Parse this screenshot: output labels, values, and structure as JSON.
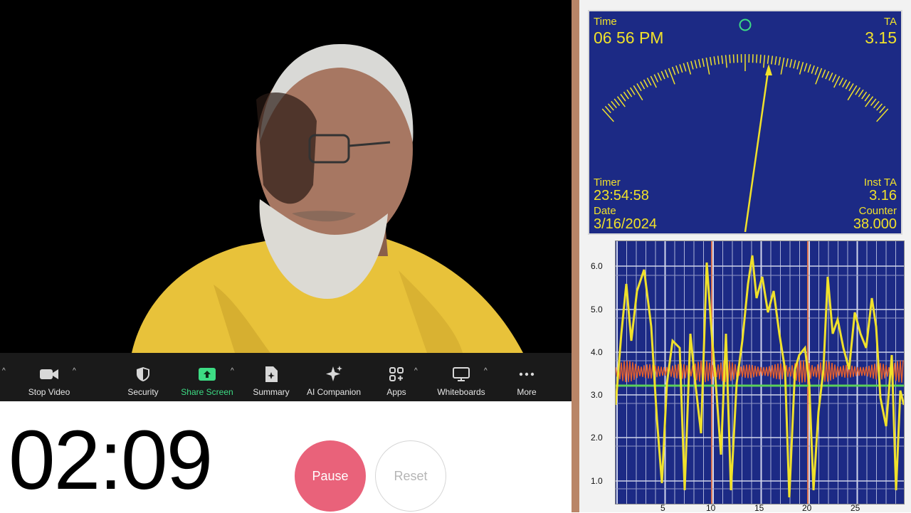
{
  "toolbar": {
    "items": [
      {
        "label": "Stop Video",
        "icon": "video-camera-icon"
      },
      {
        "label": "Security",
        "icon": "shield-icon"
      },
      {
        "label": "Share Screen",
        "icon": "share-screen-icon"
      },
      {
        "label": "Summary",
        "icon": "summary-icon"
      },
      {
        "label": "AI Companion",
        "icon": "sparkle-icon"
      },
      {
        "label": "Apps",
        "icon": "apps-icon"
      },
      {
        "label": "Whiteboards",
        "icon": "whiteboard-icon"
      },
      {
        "label": "More",
        "icon": "more-icon"
      }
    ],
    "share_color": "#3ddc84"
  },
  "timer": {
    "display": "02:09",
    "pause_label": "Pause",
    "reset_label": "Reset",
    "pause_color": "#e9627a"
  },
  "meter": {
    "time_label": "Time",
    "time_value": "06 56 PM",
    "ta_label": "TA",
    "ta_value": "3.15",
    "timer_label": "Timer",
    "timer_value": "23:54:58",
    "inst_ta_label": "Inst TA",
    "inst_ta_value": "3.16",
    "date_label": "Date",
    "date_value": "3/16/2024",
    "counter_label": "Counter",
    "counter_value": "38.000",
    "face_color": "#1c2a85",
    "needle_color": "#f0e12b"
  },
  "graph": {
    "y_ticks": [
      "6.0",
      "5.0",
      "4.0",
      "3.0",
      "2.0",
      "1.0"
    ],
    "x_ticks": [
      "5",
      "10",
      "15",
      "20",
      "25"
    ],
    "trace_color": "#f0e12b",
    "noise_color": "#e8612c",
    "baseline_color": "#5ad05a"
  }
}
